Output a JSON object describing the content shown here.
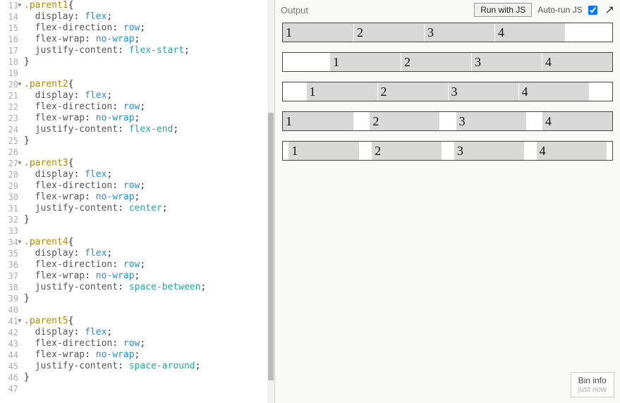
{
  "output": {
    "label": "Output",
    "run_label": "Run with JS",
    "autorun_label": "Auto-run JS",
    "autorun_checked": true,
    "cells": [
      "1",
      "2",
      "3",
      "4"
    ]
  },
  "bin_info": {
    "title": "Bin info",
    "sub": "just now"
  },
  "code_lines": [
    {
      "n": "13",
      "fold": true,
      "tokens": [
        [
          "sel",
          ".parent1"
        ],
        [
          "pun",
          "{"
        ]
      ]
    },
    {
      "n": "14",
      "tokens": [
        [
          "prop",
          "  display"
        ],
        [
          "pun",
          ": "
        ],
        [
          "val",
          "flex"
        ],
        [
          "pun",
          ";"
        ]
      ]
    },
    {
      "n": "15",
      "tokens": [
        [
          "prop",
          "  flex-direction"
        ],
        [
          "pun",
          ": "
        ],
        [
          "val",
          "row"
        ],
        [
          "pun",
          ";"
        ]
      ]
    },
    {
      "n": "16",
      "tokens": [
        [
          "prop",
          "  flex-wrap"
        ],
        [
          "pun",
          ": "
        ],
        [
          "val",
          "no-wrap"
        ],
        [
          "pun",
          ";"
        ]
      ]
    },
    {
      "n": "17",
      "tokens": [
        [
          "prop",
          "  justify-content"
        ],
        [
          "pun",
          ": "
        ],
        [
          "valt",
          "flex-start"
        ],
        [
          "pun",
          ";"
        ]
      ]
    },
    {
      "n": "18",
      "tokens": [
        [
          "pun",
          "}"
        ]
      ]
    },
    {
      "n": "19",
      "tokens": []
    },
    {
      "n": "20",
      "fold": true,
      "tokens": [
        [
          "sel",
          ".parent2"
        ],
        [
          "pun",
          "{"
        ]
      ]
    },
    {
      "n": "21",
      "tokens": [
        [
          "prop",
          "  display"
        ],
        [
          "pun",
          ": "
        ],
        [
          "val",
          "flex"
        ],
        [
          "pun",
          ";"
        ]
      ]
    },
    {
      "n": "22",
      "tokens": [
        [
          "prop",
          "  flex-direction"
        ],
        [
          "pun",
          ": "
        ],
        [
          "val",
          "row"
        ],
        [
          "pun",
          ";"
        ]
      ]
    },
    {
      "n": "23",
      "tokens": [
        [
          "prop",
          "  flex-wrap"
        ],
        [
          "pun",
          ": "
        ],
        [
          "val",
          "no-wrap"
        ],
        [
          "pun",
          ";"
        ]
      ]
    },
    {
      "n": "24",
      "tokens": [
        [
          "prop",
          "  justify-content"
        ],
        [
          "pun",
          ": "
        ],
        [
          "valt",
          "flex-end"
        ],
        [
          "pun",
          ";"
        ]
      ]
    },
    {
      "n": "25",
      "tokens": [
        [
          "pun",
          "}"
        ]
      ]
    },
    {
      "n": "26",
      "tokens": []
    },
    {
      "n": "27",
      "fold": true,
      "tokens": [
        [
          "sel",
          ".parent3"
        ],
        [
          "pun",
          "{"
        ]
      ]
    },
    {
      "n": "28",
      "tokens": [
        [
          "prop",
          "  display"
        ],
        [
          "pun",
          ": "
        ],
        [
          "val",
          "flex"
        ],
        [
          "pun",
          ";"
        ]
      ]
    },
    {
      "n": "29",
      "tokens": [
        [
          "prop",
          "  flex-direction"
        ],
        [
          "pun",
          ": "
        ],
        [
          "val",
          "row"
        ],
        [
          "pun",
          ";"
        ]
      ]
    },
    {
      "n": "30",
      "tokens": [
        [
          "prop",
          "  flex-wrap"
        ],
        [
          "pun",
          ": "
        ],
        [
          "val",
          "no-wrap"
        ],
        [
          "pun",
          ";"
        ]
      ]
    },
    {
      "n": "31",
      "tokens": [
        [
          "prop",
          "  justify-content"
        ],
        [
          "pun",
          ": "
        ],
        [
          "valt",
          "center"
        ],
        [
          "pun",
          ";"
        ]
      ]
    },
    {
      "n": "32",
      "tokens": [
        [
          "pun",
          "}"
        ]
      ]
    },
    {
      "n": "33",
      "tokens": []
    },
    {
      "n": "34",
      "fold": true,
      "tokens": [
        [
          "sel",
          ".parent4"
        ],
        [
          "pun",
          "{"
        ]
      ]
    },
    {
      "n": "35",
      "tokens": [
        [
          "prop",
          "  display"
        ],
        [
          "pun",
          ": "
        ],
        [
          "val",
          "flex"
        ],
        [
          "pun",
          ";"
        ]
      ]
    },
    {
      "n": "36",
      "tokens": [
        [
          "prop",
          "  flex-direction"
        ],
        [
          "pun",
          ": "
        ],
        [
          "val",
          "row"
        ],
        [
          "pun",
          ";"
        ]
      ]
    },
    {
      "n": "37",
      "tokens": [
        [
          "prop",
          "  flex-wrap"
        ],
        [
          "pun",
          ": "
        ],
        [
          "val",
          "no-wrap"
        ],
        [
          "pun",
          ";"
        ]
      ]
    },
    {
      "n": "38",
      "tokens": [
        [
          "prop",
          "  justify-content"
        ],
        [
          "pun",
          ": "
        ],
        [
          "valt",
          "space-between"
        ],
        [
          "pun",
          ";"
        ]
      ]
    },
    {
      "n": "39",
      "tokens": [
        [
          "pun",
          "}"
        ]
      ]
    },
    {
      "n": "40",
      "tokens": []
    },
    {
      "n": "41",
      "fold": true,
      "tokens": [
        [
          "sel",
          ".parent5"
        ],
        [
          "pun",
          "{"
        ]
      ]
    },
    {
      "n": "42",
      "tokens": [
        [
          "prop",
          "  display"
        ],
        [
          "pun",
          ": "
        ],
        [
          "val",
          "flex"
        ],
        [
          "pun",
          ";"
        ]
      ]
    },
    {
      "n": "43",
      "tokens": [
        [
          "prop",
          "  flex-direction"
        ],
        [
          "pun",
          ": "
        ],
        [
          "val",
          "row"
        ],
        [
          "pun",
          ";"
        ]
      ]
    },
    {
      "n": "44",
      "tokens": [
        [
          "prop",
          "  flex-wrap"
        ],
        [
          "pun",
          ": "
        ],
        [
          "val",
          "no-wrap"
        ],
        [
          "pun",
          ";"
        ]
      ]
    },
    {
      "n": "45",
      "tokens": [
        [
          "prop",
          "  justify-content"
        ],
        [
          "pun",
          ": "
        ],
        [
          "valt",
          "space-around"
        ],
        [
          "pun",
          ";"
        ]
      ]
    },
    {
      "n": "46",
      "tokens": [
        [
          "pun",
          "}"
        ]
      ]
    },
    {
      "n": "47",
      "tokens": []
    }
  ]
}
